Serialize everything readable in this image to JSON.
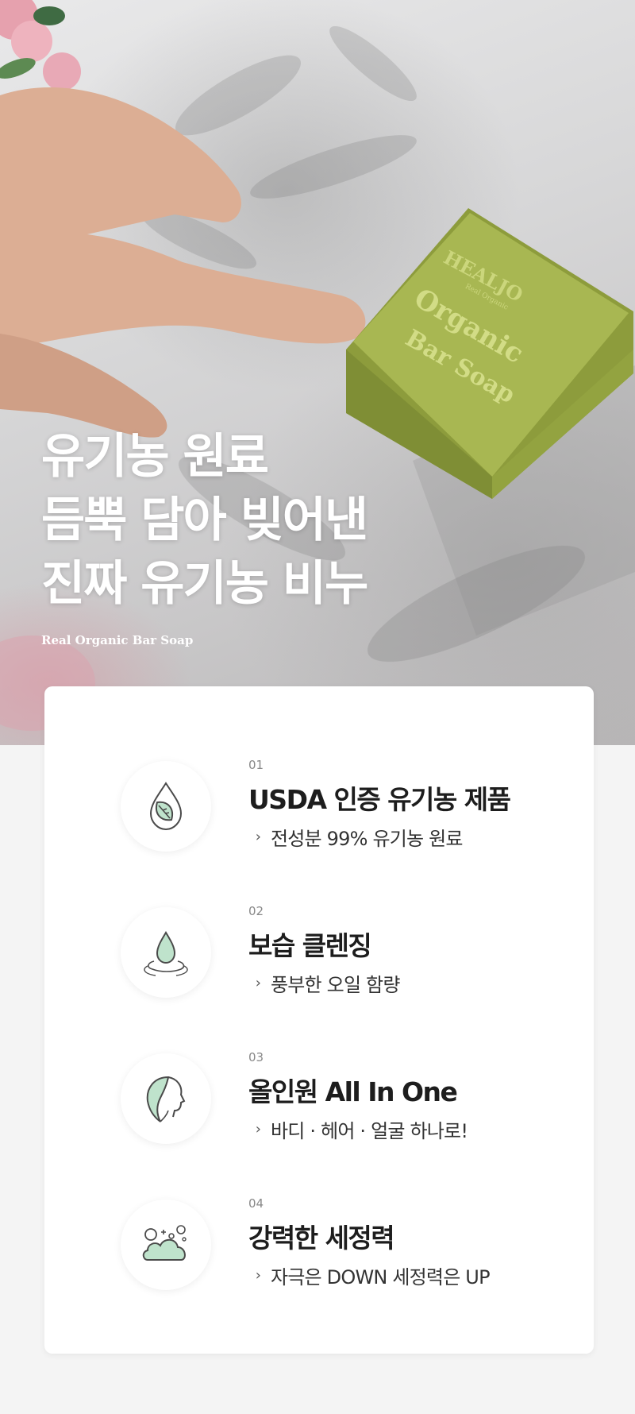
{
  "hero": {
    "title_line1": "유기농 원료",
    "title_line2": "듬뿍 담아 빚어낸",
    "title_line3": "진짜 유기농 비누",
    "subtitle": "Real Organic Bar Soap",
    "soap_brand": "HEALJO",
    "soap_tagline": "Real Organic",
    "soap_line1": "Organic",
    "soap_line2": "Bar Soap"
  },
  "colors": {
    "accent_mint": "#bfe3cc",
    "icon_stroke": "#4a4a4a",
    "soap_green": "#9fb24a"
  },
  "features": [
    {
      "num": "01",
      "title": "USDA 인증 유기농 제품",
      "desc": "전성분 99% 유기농 원료",
      "icon": "leaf-drop-icon"
    },
    {
      "num": "02",
      "title": "보습 클렌징",
      "desc": "풍부한 오일 함량",
      "icon": "water-drop-icon"
    },
    {
      "num": "03",
      "title": "올인원 All In One",
      "desc": "바디 · 헤어 · 얼굴 하나로!",
      "icon": "face-profile-icon"
    },
    {
      "num": "04",
      "title": "강력한 세정력",
      "desc": "자극은 DOWN  세정력은 UP",
      "icon": "bubble-cloud-icon"
    }
  ],
  "chevron": "›"
}
